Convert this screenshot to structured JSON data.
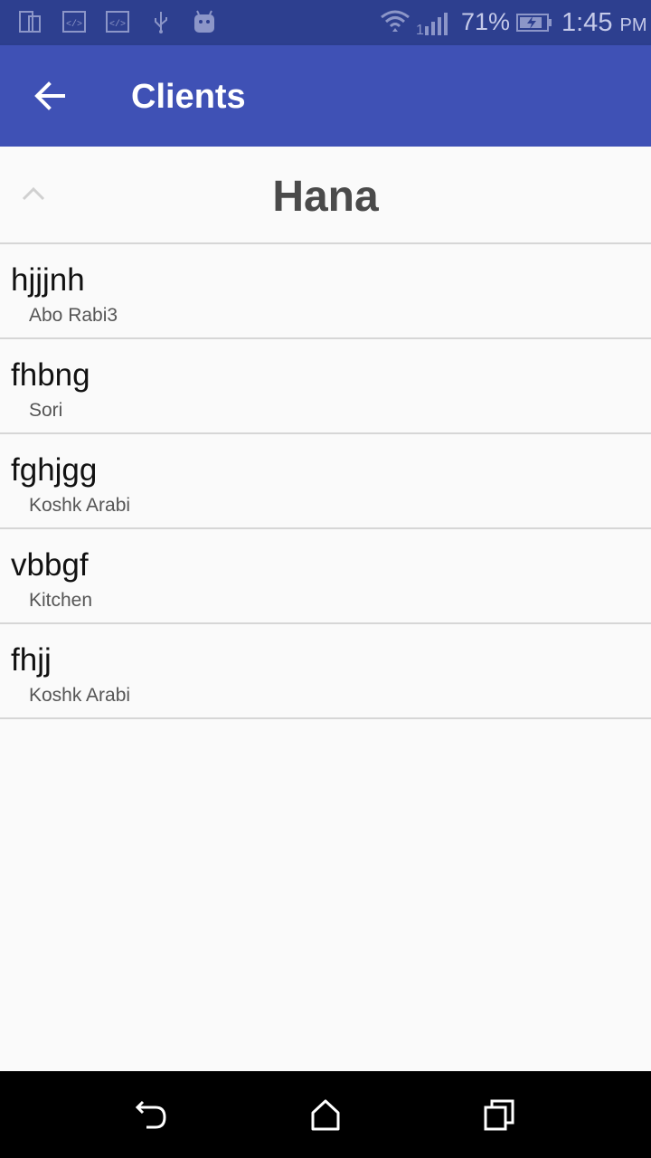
{
  "status_bar": {
    "icons_left": [
      "phone-tablet-icon",
      "code-icon",
      "code-icon",
      "usb-icon",
      "android-icon"
    ],
    "battery_percent": "71%",
    "time": "1:45",
    "ampm": "PM",
    "color": "#2d3f8f"
  },
  "app_bar": {
    "title": "Clients",
    "back_icon": "arrow-back-icon",
    "color": "#3f51b5"
  },
  "group": {
    "title": "Hana",
    "collapse_icon": "chevron-up-icon"
  },
  "clients": [
    {
      "name": "hjjjnh",
      "location": "Abo Rabi3"
    },
    {
      "name": "fhbng",
      "location": "Sori"
    },
    {
      "name": "fghjgg",
      "location": "Koshk Arabi"
    },
    {
      "name": "vbbgf",
      "location": "Kitchen"
    },
    {
      "name": "fhjj",
      "location": "Koshk Arabi"
    }
  ],
  "nav_bar": {
    "buttons": [
      "back-icon",
      "home-icon",
      "recents-icon"
    ]
  }
}
